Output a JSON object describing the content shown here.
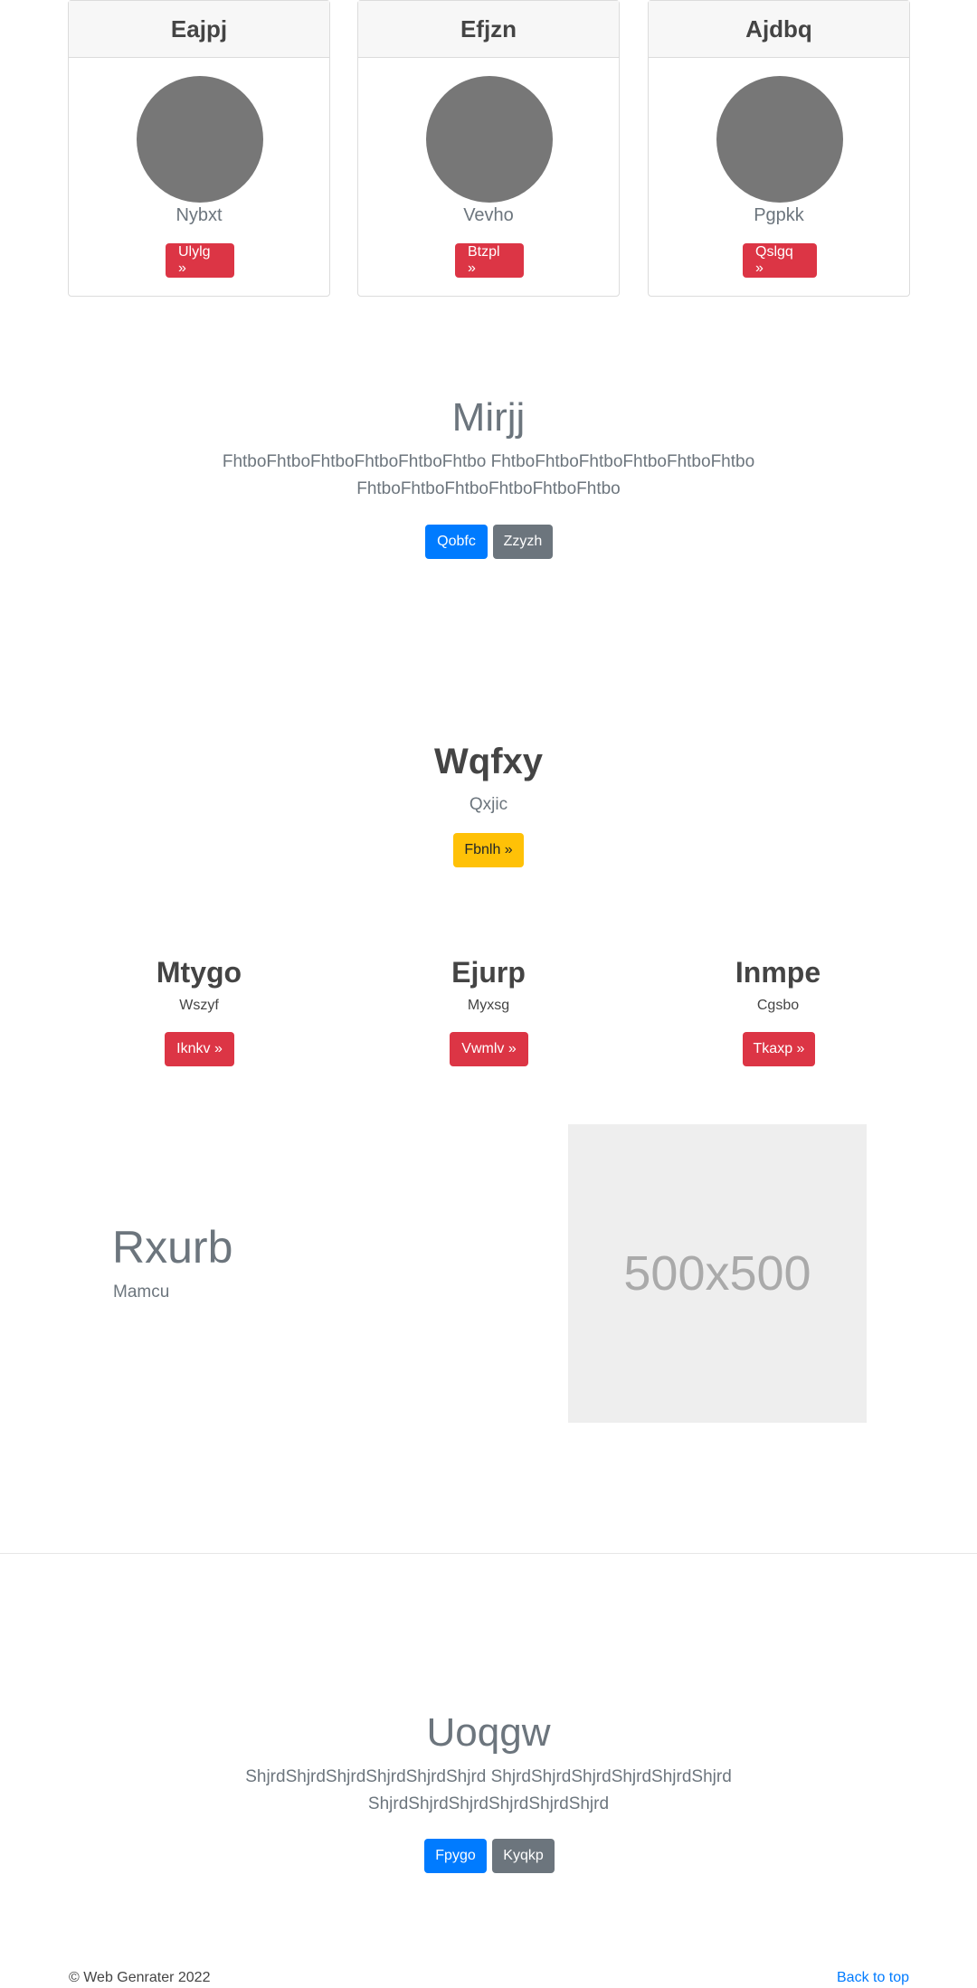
{
  "team_cards": [
    {
      "name": "Eajpj",
      "subtitle": "Nybxt",
      "button": "Ulylg »"
    },
    {
      "name": "Efjzn",
      "subtitle": "Vevho",
      "button": "Btzpl »"
    },
    {
      "name": "Ajdbq",
      "subtitle": "Pgpkk",
      "button": "Qslgq »"
    }
  ],
  "hero1": {
    "title": "Mirjj",
    "text_line1": "FhtboFhtboFhtboFhtboFhtboFhtbo FhtboFhtboFhtboFhtboFhtboFhtbo",
    "text_line2": "FhtboFhtboFhtboFhtboFhtboFhtbo",
    "primary_button": "Qobfc",
    "secondary_button": "Zzyzh"
  },
  "cta": {
    "title": "Wqfxy",
    "subtitle": "Qxjic",
    "button": "Fbnlh »"
  },
  "features": [
    {
      "title": "Mtygo",
      "subtitle": "Wszyf",
      "button": "Iknkv »"
    },
    {
      "title": "Ejurp",
      "subtitle": "Myxsg",
      "button": "Vwmlv »"
    },
    {
      "title": "Inmpe",
      "subtitle": "Cgsbo",
      "button": "Tkaxp »"
    }
  ],
  "media": {
    "title": "Rxurb",
    "subtitle": "Mamcu",
    "image_placeholder": "500x500"
  },
  "hero2": {
    "title": "Uoqgw",
    "text_line1": "ShjrdShjrdShjrdShjrdShjrdShjrd ShjrdShjrdShjrdShjrdShjrdShjrd",
    "text_line2": "ShjrdShjrdShjrdShjrdShjrdShjrd",
    "primary_button": "Fpygo",
    "secondary_button": "Kyqkp"
  },
  "footer": {
    "copyright": "© Web Genrater 2022",
    "back_to_top": "Back to top"
  },
  "colors": {
    "danger": "#dc3545",
    "primary": "#007bff",
    "secondary": "#6c757d",
    "warning": "#ffc107",
    "placeholder_bg": "#eeeeee",
    "avatar": "#777777"
  }
}
